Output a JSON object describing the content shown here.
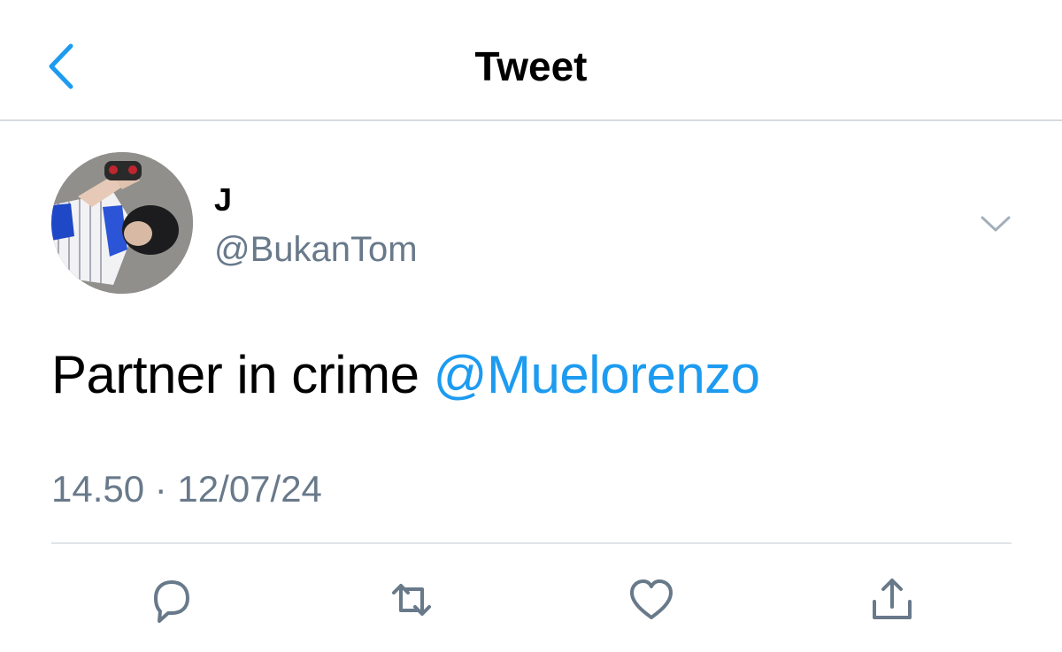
{
  "header": {
    "title": "Tweet",
    "back_icon": "chevron-left-icon"
  },
  "author": {
    "display_name": "J",
    "handle": "@BukanTom",
    "avatar_icon": "avatar",
    "menu_icon": "chevron-down-icon"
  },
  "tweet": {
    "text": "Partner in crime ",
    "mention": "@Muelorenzo",
    "timestamp": "14.50 · 12/07/24"
  },
  "actions": [
    {
      "icon": "reply-icon"
    },
    {
      "icon": "retweet-icon"
    },
    {
      "icon": "like-icon"
    },
    {
      "icon": "share-icon"
    }
  ],
  "colors": {
    "accent": "#1d9bf0",
    "secondary_text": "#68798a",
    "icon_gray": "#68798a",
    "divider": "#d7dbe0"
  }
}
